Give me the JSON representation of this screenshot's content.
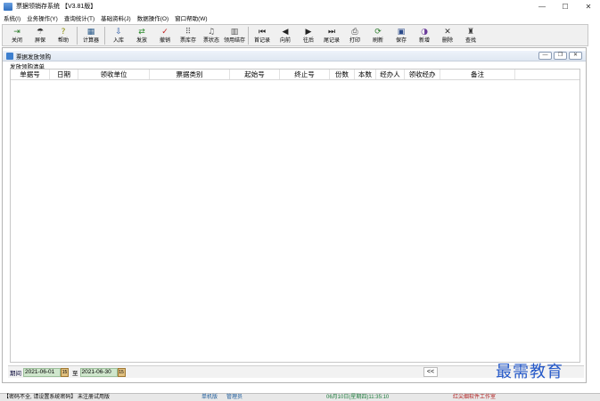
{
  "window": {
    "title": "票据领销存系统 【V3.81版】",
    "minimize": "—",
    "maximize": "☐",
    "close": "✕"
  },
  "menu": [
    "系统(I)",
    "业务操作(Y)",
    "查询统计(T)",
    "基础资料(J)",
    "数据操作(O)",
    "窗口帮助(W)"
  ],
  "toolbar": [
    {
      "label": "关闭",
      "icon": "⇥",
      "color": "#2a7a2a"
    },
    {
      "label": "屏保",
      "icon": "☂",
      "color": "#333"
    },
    {
      "label": "帮助",
      "icon": "?",
      "color": "#8a8a00"
    },
    {
      "sep": true
    },
    {
      "label": "计算器",
      "icon": "▦",
      "color": "#2a5a8a"
    },
    {
      "sep": true
    },
    {
      "label": "入库",
      "icon": "⇩",
      "color": "#2a5aa8"
    },
    {
      "label": "发放",
      "icon": "⇄",
      "color": "#2a8a2a"
    },
    {
      "label": "撤销",
      "icon": "✓",
      "color": "#c02020"
    },
    {
      "label": "票库存",
      "icon": "⠿",
      "color": "#555"
    },
    {
      "label": "票状态",
      "icon": "♫",
      "color": "#555"
    },
    {
      "label": "领用结存",
      "icon": "▥",
      "color": "#555"
    },
    {
      "sep": true
    },
    {
      "label": "首记录",
      "icon": "⏮",
      "color": "#222"
    },
    {
      "label": "向前",
      "icon": "◀",
      "color": "#222"
    },
    {
      "label": "往后",
      "icon": "▶",
      "color": "#222"
    },
    {
      "label": "尾记录",
      "icon": "⏭",
      "color": "#222"
    },
    {
      "label": "打印",
      "icon": "⎙",
      "color": "#444"
    },
    {
      "label": "刷新",
      "icon": "⟳",
      "color": "#2a7a2a"
    },
    {
      "label": "保存",
      "icon": "▣",
      "color": "#2a4a8a"
    },
    {
      "label": "新增",
      "icon": "◑",
      "color": "#6a3a9a"
    },
    {
      "label": "删除",
      "icon": "✕",
      "color": "#333"
    },
    {
      "label": "查找",
      "icon": "♜",
      "color": "#333"
    }
  ],
  "child_window": {
    "title": "票据发放领购",
    "min": "—",
    "restore": "❐",
    "close": "✕"
  },
  "group_label": "发放领购清单",
  "columns": [
    {
      "label": "单据号",
      "w": 44
    },
    {
      "label": "日期",
      "w": 32
    },
    {
      "label": "领收单位",
      "w": 80
    },
    {
      "label": "票据类别",
      "w": 90
    },
    {
      "label": "起始号",
      "w": 56
    },
    {
      "label": "终止号",
      "w": 56
    },
    {
      "label": "份数",
      "w": 28
    },
    {
      "label": "本数",
      "w": 24
    },
    {
      "label": "经办人",
      "w": 32
    },
    {
      "label": "领收经办",
      "w": 40
    },
    {
      "label": "备注",
      "w": 84
    }
  ],
  "period": {
    "label": "期间",
    "start": "2021-06-01",
    "to": "至",
    "end": "2021-06-30",
    "cal_icon": "15"
  },
  "scroll_left": "<<",
  "status": {
    "warning": "【密码不全, 请设置系统密码】 未注册试用版",
    "machine": "单机版",
    "user": "管理员",
    "datetime": "06月10日(星期四)11:35:10",
    "company": "红尖烟软件工作室"
  },
  "watermark": "最需教育"
}
